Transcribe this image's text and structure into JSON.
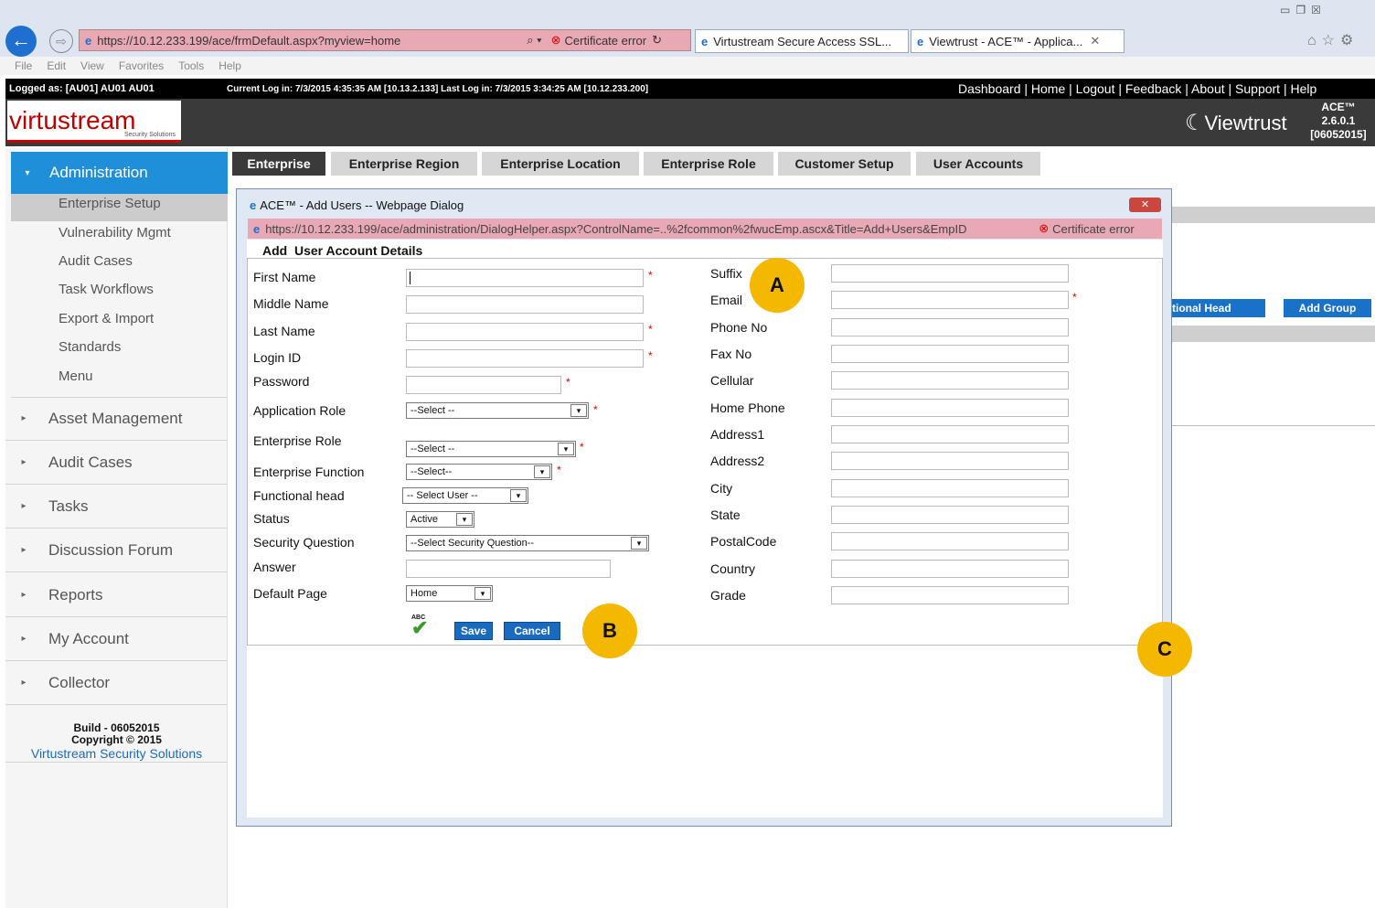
{
  "browser": {
    "url": "https://10.12.233.199/ace/frmDefault.aspx?myview=home",
    "cert_error": "Certificate error",
    "tabs": [
      "Virtustream Secure Access SSL...",
      "Viewtrust - ACE™ - Applica..."
    ],
    "menu": [
      "File",
      "Edit",
      "View",
      "Favorites",
      "Tools",
      "Help"
    ]
  },
  "topbar": {
    "logged_as": "Logged as: [AU01] AU01 AU01",
    "login_info": "Current Log in: 7/3/2015 4:35:35 AM [10.13.2.133]  Last Log in: 7/3/2015 3:34:25 AM [10.12.233.200]",
    "links": "Dashboard | Home | Logout | Feedback | About | Support | Help"
  },
  "header": {
    "logo": "virtustream",
    "logo_sub": "Security Solutions",
    "brand": "Viewtrust",
    "version_line1": "ACE™",
    "version_line2": "2.6.0.1",
    "version_line3": "[06052015]"
  },
  "sidebar": {
    "active": "Administration",
    "sub_items": [
      "Enterprise Setup",
      "Vulnerability Mgmt",
      "Audit Cases",
      "Task Workflows",
      "Export & Import",
      "Standards",
      "Menu"
    ],
    "sections": [
      "Asset Management",
      "Audit Cases",
      "Tasks",
      "Discussion Forum",
      "Reports",
      "My Account",
      "Collector"
    ],
    "footer_build": "Build - 06052015",
    "footer_copy": "Copyright © 2015",
    "footer_company": "Virtustream Security Solutions"
  },
  "tabs": [
    "Enterprise",
    "Enterprise Region",
    "Enterprise Location",
    "Enterprise Role",
    "Customer Setup",
    "User Accounts"
  ],
  "bg_buttons": [
    "tional Head",
    "Add Group"
  ],
  "dialog": {
    "title": "ACE™ - Add Users -- Webpage Dialog",
    "url": "https://10.12.233.199/ace/administration/DialogHelper.aspx?ControlName=..%2fcommon%2fwucEmp.ascx&Title=Add+Users&EmpID",
    "cert_error": "Certificate error",
    "section": "Add  User Account Details",
    "left_labels": [
      "First Name",
      "Middle Name",
      "Last Name",
      "Login ID",
      "Password",
      "Application Role",
      "Enterprise Role",
      "Enterprise Function",
      "Functional head",
      "Status",
      "Security Question",
      "Answer",
      "Default Page"
    ],
    "right_labels": [
      "Suffix",
      "Email",
      "Phone No",
      "Fax No",
      "Cellular",
      "Home Phone",
      "Address1",
      "Address2",
      "City",
      "State",
      "PostalCode",
      "Country",
      "Grade"
    ],
    "selects": {
      "app_role": "--Select --",
      "ent_role": "--Select --",
      "ent_function": "--Select--",
      "functional_head": "-- Select User --",
      "status": "Active",
      "security_question": "--Select Security Question--",
      "default_page": "Home"
    },
    "save": "Save",
    "cancel": "Cancel",
    "spell": "ABC"
  },
  "badges": [
    "A",
    "B",
    "C"
  ]
}
